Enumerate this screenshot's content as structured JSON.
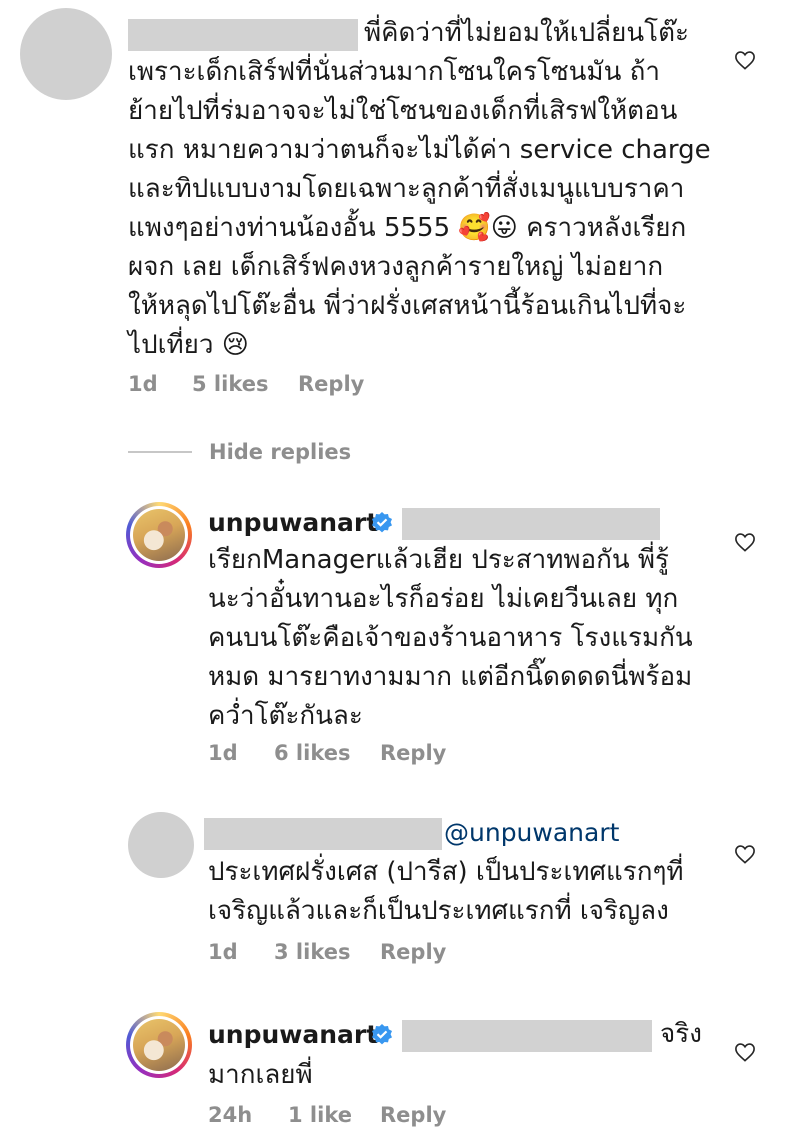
{
  "comments": [
    {
      "username": "",
      "text": "พี่คิดว่าที่ไม่ยอมให้เปลี่ยนโต๊ะ\nเพราะเด็กเสิร์ฟที่นั่นส่วนมากโซนใครโซนมัน ถ้า\nย้ายไปที่ร่มอาจจะไม่ใช่โซนของเด็กที่เสิรฟให้ตอน\nแรก หมายความว่าตนก็จะไม่ได้ค่า service charge\nและทิปแบบงามโดยเฉพาะลูกค้าที่สั่งเมนูแบบราคา\nแพงๆอย่างท่านน้องอั้น 5555 🥰😛 คราวหลังเรียก\nผจก เลย เด็กเสิร์ฟคงหวงลูกค้ารายใหญ่ ไม่อยาก\nให้หลุดไปโต๊ะอื่น พี่ว่าฝรั่งเศสหน้านี้ร้อนเกินไปที่จะ\nไปเที่ยว 😢",
      "time": "1d",
      "likes": "5 likes",
      "reply": "Reply"
    },
    {
      "username": "unpuwanart",
      "text": "เรียกManagerแล้วเฮีย ประสาทพอกัน พี่รู้\nนะว่าอั๋นทานอะไรก็อร่อย ไม่เคยวีนเลย ทุก\nคนบนโต๊ะคือเจ้าของร้านอาหาร โรงแรมกัน\nหมด มารยาทงามมาก แต่อีกนิ๊ดดดดนี่พร้อม\nคว่ำโต๊ะกันละ",
      "time": "1d",
      "likes": "6 likes",
      "reply": "Reply"
    },
    {
      "username": "",
      "mention": "@unpuwanart",
      "text": "ประเทศฝรั่งเศส (ปารีส) เป็นประเทศแรกๆที่\nเจริญแล้วและก็เป็นประเทศแรกที่ เจริญลง",
      "time": "1d",
      "likes": "3 likes",
      "reply": "Reply"
    },
    {
      "username": "unpuwanart",
      "inline_tail": "จริง",
      "text": "มากเลยพี่",
      "time": "24h",
      "likes": "1 like",
      "reply": "Reply"
    }
  ],
  "hide_replies": "Hide replies",
  "icons": {
    "like": "heart-outline-icon",
    "verified": "verified-badge-icon"
  },
  "colors": {
    "meta": "#8e8e8e",
    "mention": "#00376b",
    "verified": "#3897f0"
  }
}
